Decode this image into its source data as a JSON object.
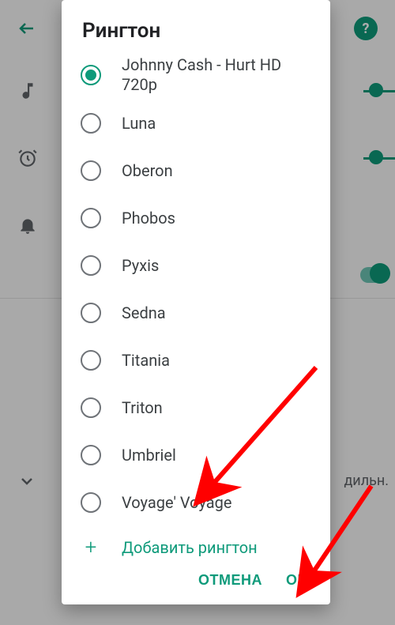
{
  "colors": {
    "accent": "#0e9a7a",
    "arrow": "#ff0000"
  },
  "bg": {
    "truncated_text": "дильн."
  },
  "dialog": {
    "title": "Рингтон",
    "items": [
      {
        "label": "Johnny Cash - Hurt HD 720p",
        "selected": true
      },
      {
        "label": "Luna",
        "selected": false
      },
      {
        "label": "Oberon",
        "selected": false
      },
      {
        "label": "Phobos",
        "selected": false
      },
      {
        "label": "Pyxis",
        "selected": false
      },
      {
        "label": "Sedna",
        "selected": false
      },
      {
        "label": "Titania",
        "selected": false
      },
      {
        "label": "Triton",
        "selected": false
      },
      {
        "label": "Umbriel",
        "selected": false
      },
      {
        "label": "Voyage' Voyage",
        "selected": false
      }
    ],
    "add_label": "Добавить рингтон",
    "cancel": "ОТМЕНА",
    "ok": "OK"
  }
}
